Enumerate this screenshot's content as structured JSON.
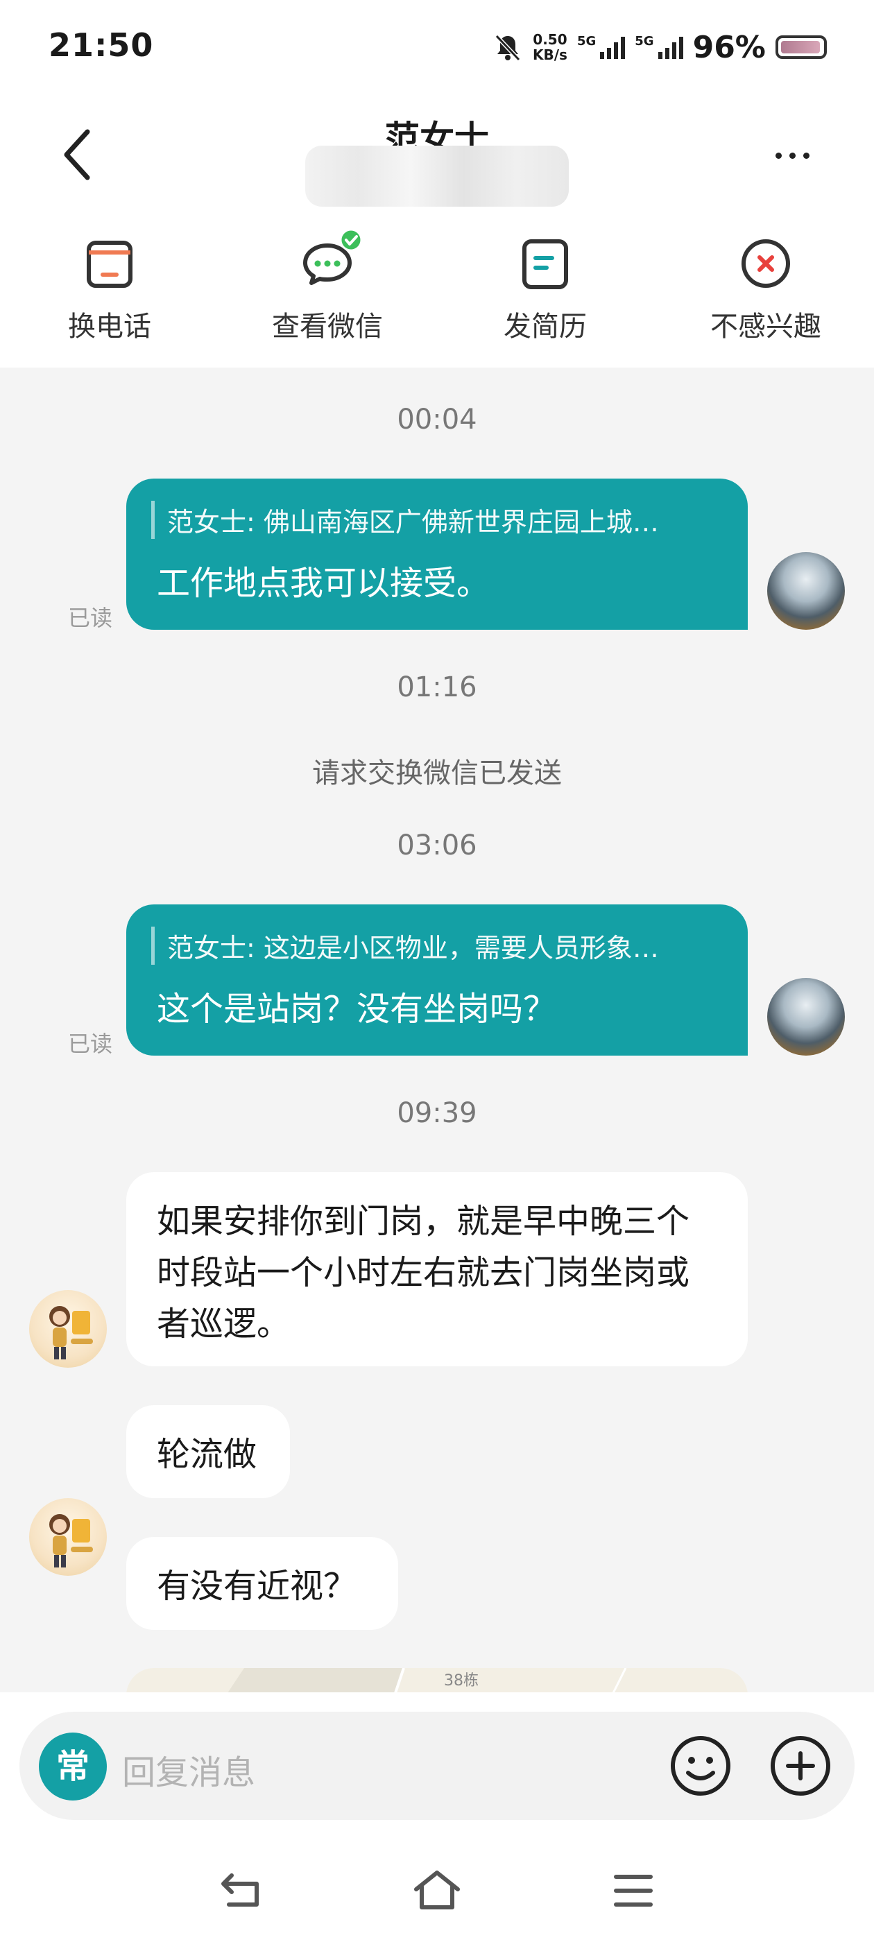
{
  "status_bar": {
    "time": "21:50",
    "speed_value": "0.50",
    "speed_unit": "KB/s",
    "network_1": "5G",
    "network_2": "5G",
    "battery": "96%"
  },
  "header": {
    "title": "范女士"
  },
  "actions": [
    {
      "label": "换电话",
      "icon": "phone-icon"
    },
    {
      "label": "查看微信",
      "icon": "wechat-icon"
    },
    {
      "label": "发简历",
      "icon": "resume-icon"
    },
    {
      "label": "不感兴趣",
      "icon": "not-interested-icon"
    }
  ],
  "chat": {
    "ts1": "00:04",
    "msg1_quote": "范女士: 佛山南海区广佛新世界庄园上城…",
    "msg1_text": "工作地点我可以接受。",
    "read_label": "已读",
    "ts2": "01:16",
    "system_msg": "请求交换微信已发送",
    "ts3": "03:06",
    "msg2_quote": "范女士: 这边是小区物业，需要人员形象…",
    "msg2_text": "这个是站岗？没有坐岗吗？",
    "ts4": "09:39",
    "in1_text": "如果安排你到门岗，就是早中晚三个时段站一个小时左右就去门岗坐岗或者巡逻。",
    "in2_text": "轮流做",
    "in3_text": "有没有近视？",
    "map_label": "38栋"
  },
  "input": {
    "quick_button": "常",
    "placeholder": "回复消息"
  },
  "colors": {
    "accent": "#14a0a5",
    "badge_green": "#3cbf5a",
    "danger": "#e8413c",
    "phone_orange": "#f07a52"
  }
}
